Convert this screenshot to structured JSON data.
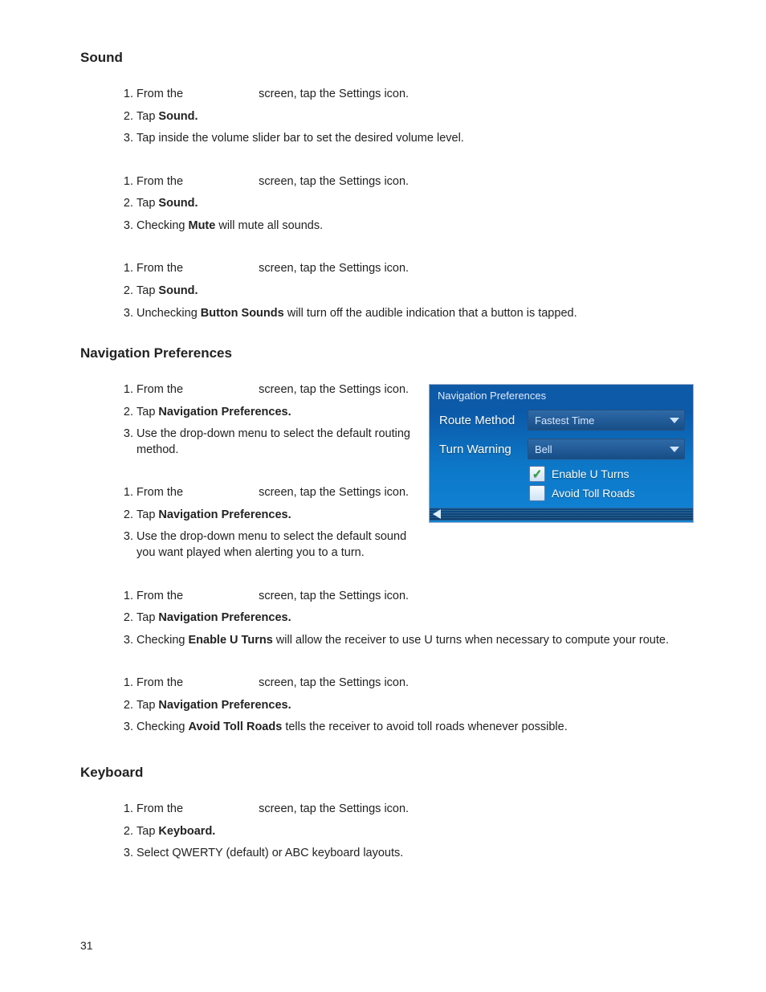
{
  "pageNumber": "31",
  "sections": [
    {
      "heading": "Sound",
      "fig": null,
      "blocks": [
        [
          {
            "segments": [
              {
                "t": "From the "
              },
              {
                "gap": true
              },
              {
                "t": " screen, tap the Settings icon."
              }
            ]
          },
          {
            "segments": [
              {
                "t": "Tap "
              },
              {
                "t": "Sound.",
                "b": true
              }
            ]
          },
          {
            "segments": [
              {
                "t": "Tap inside the volume slider bar to set the desired volume level."
              }
            ]
          }
        ],
        [
          {
            "segments": [
              {
                "t": "From the "
              },
              {
                "gap": true
              },
              {
                "t": " screen, tap the Settings icon."
              }
            ]
          },
          {
            "segments": [
              {
                "t": "Tap "
              },
              {
                "t": "Sound.",
                "b": true
              }
            ]
          },
          {
            "segments": [
              {
                "t": "Checking "
              },
              {
                "t": "Mute",
                "b": true
              },
              {
                "t": " will mute all sounds."
              }
            ]
          }
        ],
        [
          {
            "segments": [
              {
                "t": "From the "
              },
              {
                "gap": true
              },
              {
                "t": " screen, tap the Settings icon."
              }
            ]
          },
          {
            "segments": [
              {
                "t": "Tap "
              },
              {
                "t": "Sound.",
                "b": true
              }
            ]
          },
          {
            "segments": [
              {
                "t": "Unchecking "
              },
              {
                "t": "Button Sounds",
                "b": true
              },
              {
                "t": " will turn off the audible indication that a button is tapped."
              }
            ]
          }
        ]
      ]
    },
    {
      "heading": "Navigation Preferences",
      "fig": {
        "title": "Navigation Preferences",
        "rows": [
          {
            "label": "Route Method",
            "value": "Fastest Time"
          },
          {
            "label": "Turn Warning",
            "value": "Bell"
          }
        ],
        "checks": [
          {
            "label": "Enable U Turns",
            "checked": true
          },
          {
            "label": "Avoid Toll Roads",
            "checked": false
          }
        ]
      },
      "blocks": [
        [
          {
            "segments": [
              {
                "t": "From the "
              },
              {
                "gap": true
              },
              {
                "t": " screen, tap the Settings icon."
              }
            ]
          },
          {
            "segments": [
              {
                "t": "Tap "
              },
              {
                "t": "Navigation Preferences.",
                "b": true
              }
            ]
          },
          {
            "segments": [
              {
                "t": "Use the drop-down menu to select the default routing method."
              }
            ]
          }
        ],
        [
          {
            "segments": [
              {
                "t": "From the "
              },
              {
                "gap": true
              },
              {
                "t": " screen, tap the Settings icon."
              }
            ]
          },
          {
            "segments": [
              {
                "t": "Tap "
              },
              {
                "t": "Navigation Preferences.",
                "b": true
              }
            ]
          },
          {
            "segments": [
              {
                "t": "Use the drop-down menu to select the default sound you want played when alerting you to a turn."
              }
            ]
          }
        ],
        [
          {
            "segments": [
              {
                "t": "From the "
              },
              {
                "gap": true
              },
              {
                "t": " screen, tap the Settings icon."
              }
            ]
          },
          {
            "segments": [
              {
                "t": "Tap "
              },
              {
                "t": "Navigation Preferences.",
                "b": true
              }
            ]
          },
          {
            "segments": [
              {
                "t": "Checking "
              },
              {
                "t": "Enable U Turns",
                "b": true
              },
              {
                "t": " will allow the receiver to use U turns when necessary to compute your route."
              }
            ]
          }
        ],
        [
          {
            "segments": [
              {
                "t": "From the "
              },
              {
                "gap": true
              },
              {
                "t": " screen, tap the Settings icon."
              }
            ]
          },
          {
            "segments": [
              {
                "t": "Tap "
              },
              {
                "t": "Navigation Preferences.",
                "b": true
              }
            ]
          },
          {
            "segments": [
              {
                "t": "Checking "
              },
              {
                "t": "Avoid Toll Roads",
                "b": true
              },
              {
                "t": " tells the receiver to avoid toll roads whenever possible."
              }
            ]
          }
        ]
      ]
    },
    {
      "heading": "Keyboard",
      "fig": null,
      "blocks": [
        [
          {
            "segments": [
              {
                "t": "From the "
              },
              {
                "gap": true
              },
              {
                "t": " screen, tap the Settings icon."
              }
            ]
          },
          {
            "segments": [
              {
                "t": "Tap "
              },
              {
                "t": "Keyboard.",
                "b": true
              }
            ]
          },
          {
            "segments": [
              {
                "t": "Select QWERTY (default) or ABC keyboard layouts."
              }
            ]
          }
        ]
      ]
    }
  ]
}
